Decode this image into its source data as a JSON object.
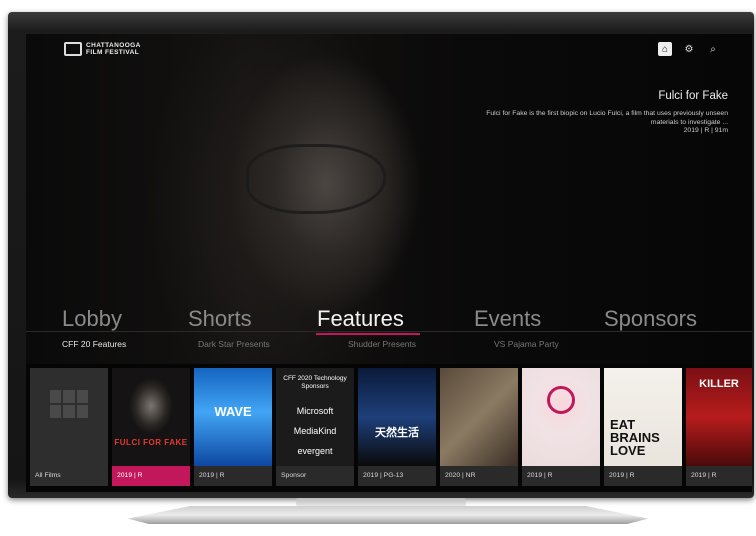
{
  "brand": {
    "logo_text": "CHATTANOOGA FILM FESTIVAL"
  },
  "top_icons": [
    {
      "name": "home-icon",
      "glyph": "⌂",
      "active": true
    },
    {
      "name": "gear-icon",
      "glyph": "⚙",
      "active": false
    },
    {
      "name": "search-icon",
      "glyph": "⌕",
      "active": false
    }
  ],
  "featured": {
    "title": "Fulci for Fake",
    "description": "Fulci for Fake is the first biopic on Lucio Fulci, a film that uses previously unseen materials to investigate ...",
    "meta": "2019 | R | 91m"
  },
  "nav": {
    "tabs": [
      "Lobby",
      "Shorts",
      "Features",
      "Events",
      "Sponsors"
    ],
    "active_index": 2
  },
  "subnav": {
    "items": [
      "CFF 20 Features",
      "Dark Star Presents",
      "Shudder Presents",
      "VS Pajama Party"
    ],
    "active_index": 0
  },
  "tiles": [
    {
      "caption": "All Films"
    },
    {
      "caption": "2019 | R",
      "art_title": "FULCI FOR FAKE",
      "highlighted": true
    },
    {
      "caption": "2019 | R",
      "art_title": "WAVE"
    },
    {
      "caption": "Sponsor",
      "sponsor_heading": "CFF 2020 Technology Sponsors",
      "sponsors": [
        "Microsoft",
        "MediaKind",
        "evergent"
      ]
    },
    {
      "caption": "2019 | PG-13",
      "art_title": "天然生活"
    },
    {
      "caption": "2020 | NR"
    },
    {
      "caption": "2019 | R"
    },
    {
      "caption": "2019 | R",
      "art_title": "EAT BRAINS LOVE"
    },
    {
      "caption": "2019 | R",
      "art_title": "KILLER"
    }
  ],
  "colors": {
    "accent": "#c2185b",
    "background": "#050505",
    "tile_caption": "#2a2a2a"
  }
}
